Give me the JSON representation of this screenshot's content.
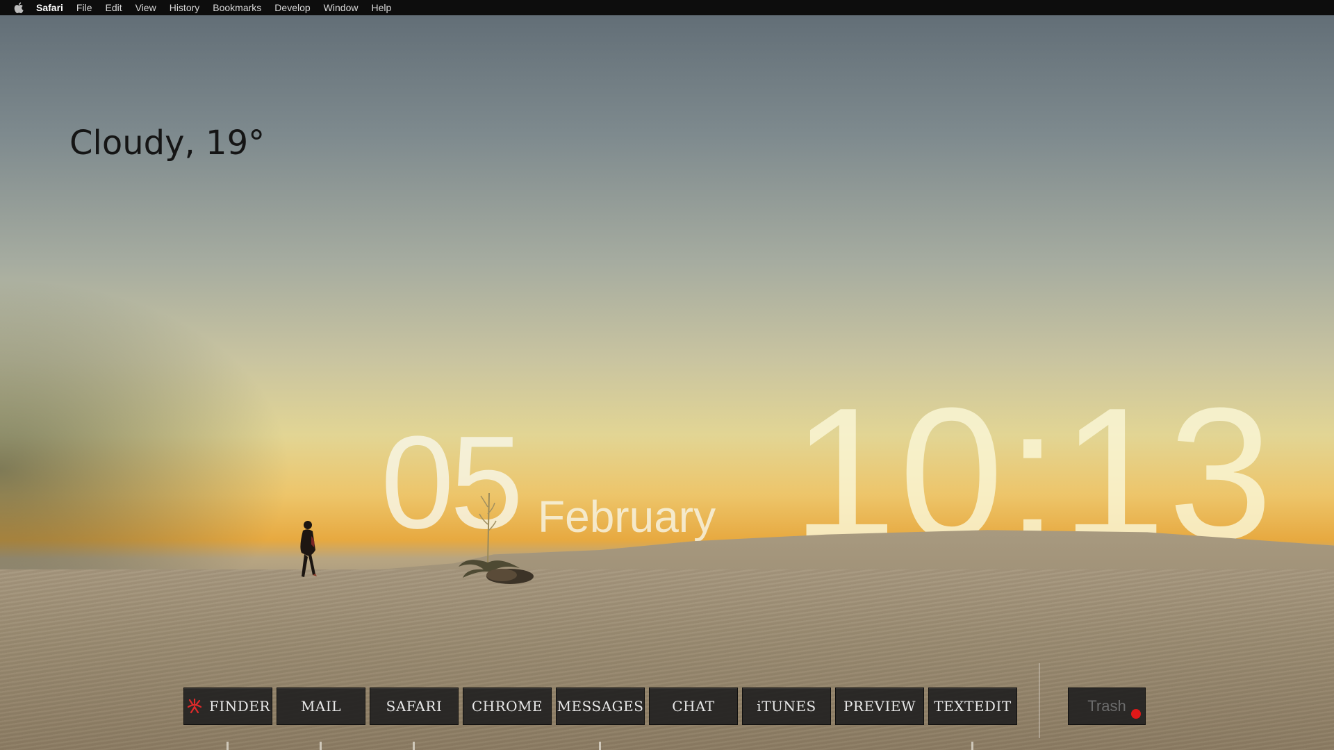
{
  "menubar": {
    "apple_icon": "apple-icon",
    "app_name": "Safari",
    "items": [
      "File",
      "Edit",
      "View",
      "History",
      "Bookmarks",
      "Develop",
      "Window",
      "Help"
    ]
  },
  "weather": {
    "text": "Cloudy, 19°"
  },
  "datetime": {
    "day": "05",
    "month": "February",
    "time": "10:13"
  },
  "dock": {
    "apps": [
      {
        "label": "FINDER",
        "icon": "finder-icon",
        "icon_color": "#e02a2a",
        "running": true
      },
      {
        "label": "MAIL",
        "running": true
      },
      {
        "label": "SAFARI",
        "running": true
      },
      {
        "label": "CHROME",
        "running": false
      },
      {
        "label": "MESSAGES",
        "running": true
      },
      {
        "label": "CHAT",
        "running": false
      },
      {
        "label": "iTUNES",
        "running": false
      },
      {
        "label": "PREVIEW",
        "running": false
      },
      {
        "label": "TEXTEDIT",
        "running": true
      }
    ],
    "trash_label": "Trash",
    "trash_badge_color": "#e01818"
  }
}
